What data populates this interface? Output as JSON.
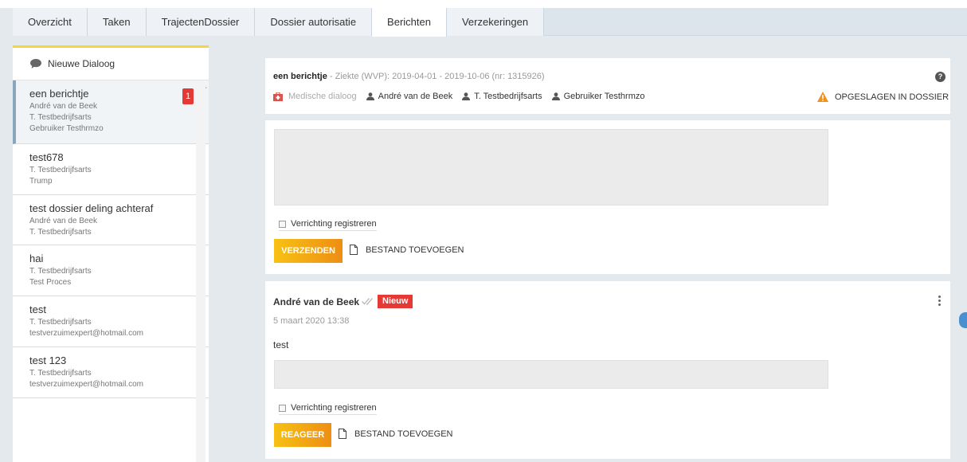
{
  "tabs": [
    {
      "label": "Overzicht"
    },
    {
      "label": "Taken"
    },
    {
      "label": "TrajectenDossier"
    },
    {
      "label": "Dossier autorisatie"
    },
    {
      "label": "Berichten"
    },
    {
      "label": "Verzekeringen"
    }
  ],
  "active_tab": "Berichten",
  "sidebar": {
    "new_dialog_label": "Nieuwe Dialoog",
    "items": [
      {
        "title": "een berichtje",
        "lines": [
          "André van de Beek",
          "T. Testbedrijfsarts",
          "Gebruiker Testhrmzo"
        ],
        "badge": "1"
      },
      {
        "title": "test678",
        "lines": [
          "T. Testbedrijfsarts",
          "Trump"
        ]
      },
      {
        "title": "test dossier deling achteraf",
        "lines": [
          "André van de Beek",
          "T. Testbedrijfsarts"
        ]
      },
      {
        "title": "hai",
        "lines": [
          "T. Testbedrijfsarts",
          "Test Proces"
        ]
      },
      {
        "title": "test",
        "lines": [
          "T. Testbedrijfsarts",
          "testverzuimexpert@hotmail.com"
        ]
      },
      {
        "title": "test 123",
        "lines": [
          "T. Testbedrijfsarts",
          "testverzuimexpert@hotmail.com"
        ]
      }
    ]
  },
  "header": {
    "title": "een berichtje",
    "meta": " - Ziekte (WVP): 2019-04-01 - 2019-10-06 (nr: 1315926)",
    "medical_label": "Medische dialoog",
    "participants": [
      "André van de Beek",
      "T. Testbedrijfsarts",
      "Gebruiker Testhrmzo"
    ],
    "saved_label": "OPGESLAGEN IN DOSSIER"
  },
  "compose": {
    "checkbox_label": "Verrichting registreren",
    "send_label": "VERZENDEN",
    "attach_label": "BESTAND TOEVOEGEN"
  },
  "message": {
    "author": "André van de Beek",
    "new_label": "Nieuw",
    "date": "5 maart 2020 13:38",
    "body": "test",
    "checkbox_label": "Verrichting registreren",
    "reply_label": "REAGEER",
    "attach_label": "BESTAND TOEVOEGEN"
  },
  "colors": {
    "accent_yellow": "#f7c113",
    "accent_orange": "#ee8e14",
    "badge_red": "#e53935",
    "warning_orange": "#f0921c"
  },
  "icons": {
    "new_dialog": "speech-bubble-icon",
    "medical": "medical-kit-icon",
    "person": "user-icon",
    "warning": "warning-icon",
    "help": "question-circle-icon",
    "attach": "file-icon",
    "read": "double-check-icon",
    "menu": "kebab-icon"
  }
}
